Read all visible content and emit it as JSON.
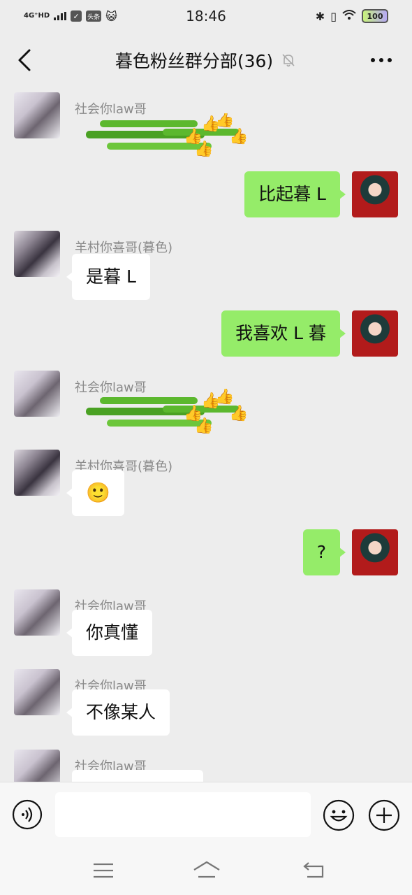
{
  "status_bar": {
    "network": "4G⁺HD",
    "app_badge": "头条",
    "time": "18:46",
    "battery": "100"
  },
  "header": {
    "title": "暮色粉丝群分部(36)"
  },
  "messages": [
    {
      "side": "in",
      "sender": "社会你law哥",
      "type": "sticker",
      "sticker": "green-onion-thumbs-up"
    },
    {
      "side": "out",
      "type": "text",
      "text": "比起暮 L"
    },
    {
      "side": "in",
      "sender": "羊村你喜哥(暮色)",
      "type": "text",
      "text": "是暮 L"
    },
    {
      "side": "out",
      "type": "text",
      "text": "我喜欢 L 暮"
    },
    {
      "side": "in",
      "sender": "社会你law哥",
      "type": "sticker",
      "sticker": "green-onion-thumbs-up"
    },
    {
      "side": "in",
      "sender": "羊村你喜哥(暮色)",
      "type": "emoji",
      "text": "🙂"
    },
    {
      "side": "out",
      "type": "text",
      "text": "?"
    },
    {
      "side": "in",
      "sender": "社会你law哥",
      "type": "text",
      "text": "你真懂"
    },
    {
      "side": "in",
      "sender": "社会你law哥",
      "type": "text",
      "text": "不像某人"
    },
    {
      "side": "in",
      "sender": "社会你law哥",
      "type": "text",
      "text": ""
    }
  ],
  "input": {
    "value": "",
    "placeholder": ""
  },
  "colors": {
    "background": "#ededed",
    "outgoing_bubble": "#95ec69",
    "incoming_bubble": "#ffffff"
  },
  "icons": {
    "back": "chevron-left-icon",
    "mute": "bell-off-icon",
    "more": "more-dots-icon",
    "voice": "voice-icon",
    "emoji": "emoji-icon",
    "plus": "plus-icon",
    "sys_menu": "menu-icon",
    "sys_home": "home-icon",
    "sys_back": "back-icon"
  }
}
